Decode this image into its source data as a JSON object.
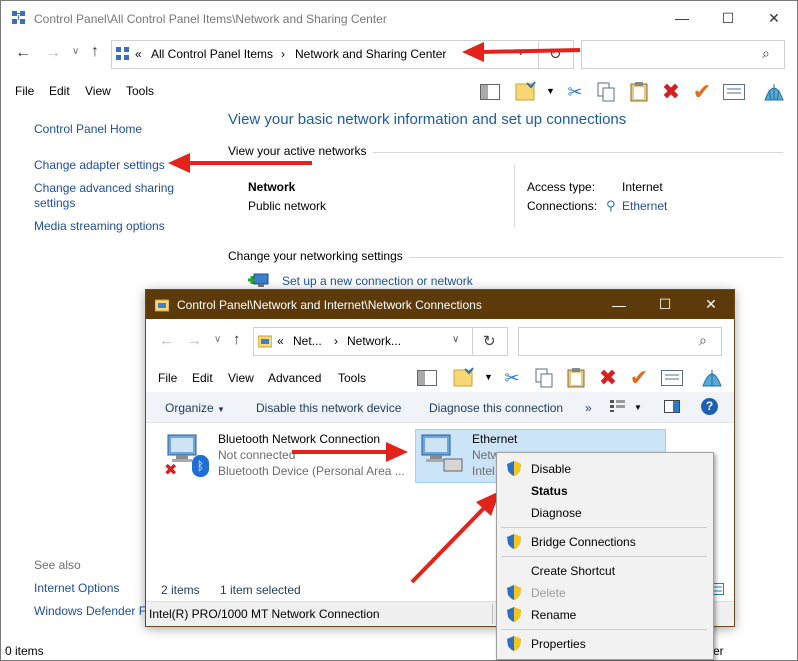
{
  "outer": {
    "title": "Control Panel\\All Control Panel Items\\Network and Sharing Center",
    "breadcrumb": [
      "«",
      "All Control Panel Items",
      "›",
      "Network and Sharing Center"
    ],
    "menu": [
      "File",
      "Edit",
      "View",
      "Tools"
    ],
    "sidebar": {
      "home": "Control Panel Home",
      "adapter": "Change adapter settings",
      "advanced": "Change advanced sharing settings",
      "media": "Media streaming options",
      "see_also": "See also",
      "internet_options": "Internet Options",
      "defender": "Windows Defender Fi"
    },
    "heading": "View your basic network information and set up connections",
    "active_networks": "View your active networks",
    "network_name": "Network",
    "network_type": "Public network",
    "access_type_label": "Access type:",
    "access_type_value": "Internet",
    "connections_label": "Connections:",
    "connections_value": "Ethernet",
    "change_settings": "Change your networking settings",
    "setup_link": "Set up a new connection or network",
    "status_items": "0 items",
    "status_right": "er"
  },
  "inner": {
    "title": "Control Panel\\Network and Internet\\Network Connections",
    "breadcrumb": [
      "«",
      "Net...",
      "›",
      "Network..."
    ],
    "menu": [
      "File",
      "Edit",
      "View",
      "Advanced",
      "Tools"
    ],
    "cmd": {
      "organize": "Organize",
      "disable": "Disable this network device",
      "diagnose": "Diagnose this connection",
      "more": "»"
    },
    "bt": {
      "name": "Bluetooth Network Connection",
      "status": "Not connected",
      "device": "Bluetooth Device (Personal Area ..."
    },
    "eth": {
      "name": "Ethernet",
      "status": "Netw",
      "device": "Intel"
    },
    "count": "2 items",
    "selected": "1 item selected",
    "device_line": "Intel(R) PRO/1000 MT Network Connection"
  },
  "context_menu": {
    "disable": "Disable",
    "status": "Status",
    "diagnose": "Diagnose",
    "bridge": "Bridge Connections",
    "shortcut": "Create Shortcut",
    "delete": "Delete",
    "rename": "Rename",
    "properties": "Properties"
  },
  "colors": {
    "link": "#1e4e9c",
    "heading": "#1e5aa8",
    "arrow": "#e32219",
    "inner_title": "#5d3a0a",
    "selection": "#cce4f7"
  }
}
